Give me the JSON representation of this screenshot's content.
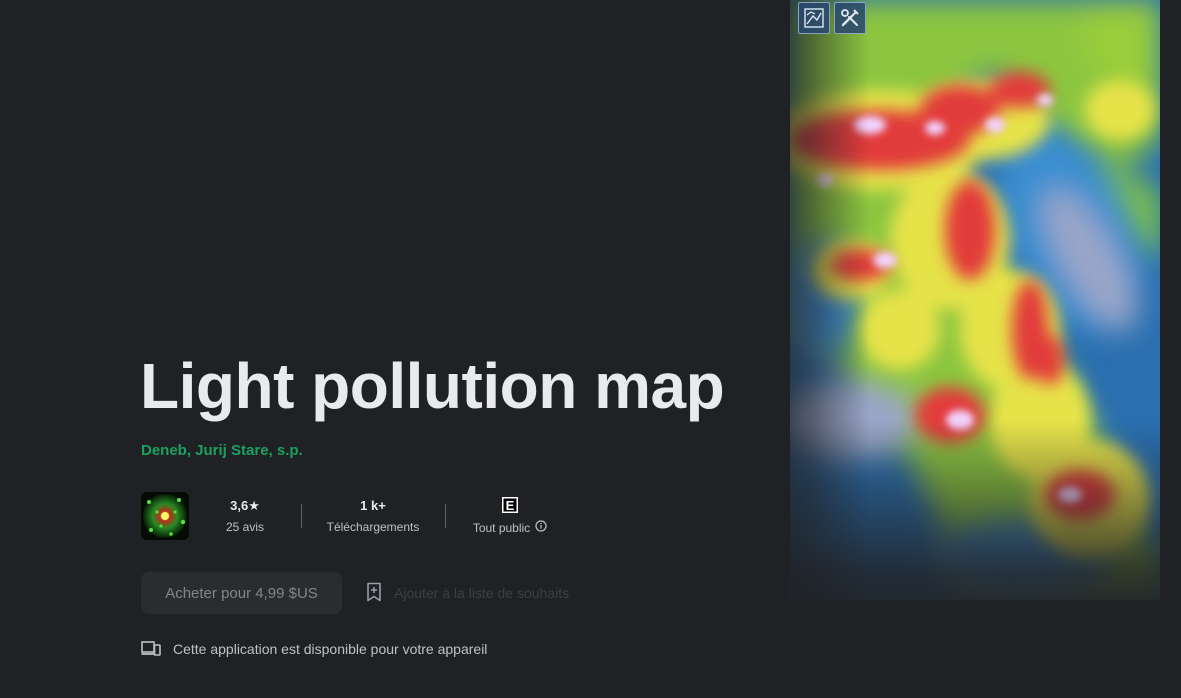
{
  "app": {
    "title": "Light pollution map",
    "developer": "Deneb, Jurij Stare, s.p."
  },
  "stats": {
    "rating": {
      "value": "3,6★",
      "label": "25 avis"
    },
    "downloads": {
      "value": "1 k+",
      "label": "Téléchargements"
    },
    "content_rating": {
      "icon": "esrb-e-icon",
      "label": "Tout public"
    }
  },
  "actions": {
    "buy_label": "Acheter pour 4,99 $US",
    "wishlist_label": "Ajouter à la liste de souhaits"
  },
  "availability": {
    "icon": "devices-icon",
    "text": "Cette application est disponible pour votre appareil"
  },
  "hero": {
    "toolbar_icons": [
      "map-layers-icon",
      "tools-icon"
    ]
  },
  "colors": {
    "background": "#202124",
    "developer_link": "#1aa05f",
    "title": "#e8eaed"
  }
}
